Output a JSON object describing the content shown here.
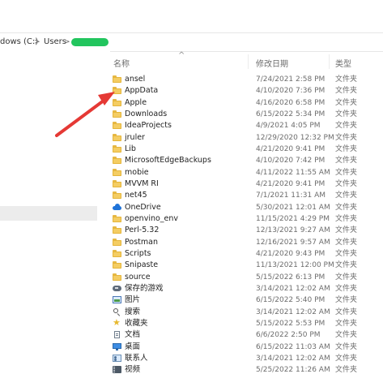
{
  "address_bar": {
    "path_start": "dows (C:)",
    "separator": ">",
    "users": "Users"
  },
  "columns": {
    "name": "名称",
    "modified": "修改日期",
    "type": "类型"
  },
  "sort_indicator": "^",
  "rows": [
    {
      "icon": "folder-icon",
      "name": "ansel",
      "date": "7/24/2021 2:58 PM",
      "type": "文件夹"
    },
    {
      "icon": "folder-icon",
      "name": "AppData",
      "date": "4/10/2020 7:36 PM",
      "type": "文件夹"
    },
    {
      "icon": "folder-icon",
      "name": "Apple",
      "date": "4/16/2020 6:58 PM",
      "type": "文件夹"
    },
    {
      "icon": "folder-icon",
      "name": "Downloads",
      "date": "6/15/2022 5:34 PM",
      "type": "文件夹"
    },
    {
      "icon": "folder-icon",
      "name": "IdeaProjects",
      "date": "4/9/2021 4:05 PM",
      "type": "文件夹"
    },
    {
      "icon": "folder-icon",
      "name": "jruler",
      "date": "12/29/2020 12:32 PM",
      "type": "文件夹"
    },
    {
      "icon": "folder-icon",
      "name": "Lib",
      "date": "4/21/2020 9:41 PM",
      "type": "文件夹"
    },
    {
      "icon": "folder-icon",
      "name": "MicrosoftEdgeBackups",
      "date": "4/10/2020 7:42 PM",
      "type": "文件夹"
    },
    {
      "icon": "folder-icon",
      "name": "mobie",
      "date": "4/11/2022 11:55 AM",
      "type": "文件夹"
    },
    {
      "icon": "folder-icon",
      "name": "MVVM RI",
      "date": "4/21/2020 9:41 PM",
      "type": "文件夹"
    },
    {
      "icon": "folder-icon",
      "name": "net45",
      "date": "7/1/2021 11:31 AM",
      "type": "文件夹"
    },
    {
      "icon": "onedrive-cloud-icon",
      "name": "OneDrive",
      "date": "5/30/2021 12:01 AM",
      "type": "文件夹"
    },
    {
      "icon": "folder-icon",
      "name": "openvino_env",
      "date": "11/15/2021 4:29 PM",
      "type": "文件夹"
    },
    {
      "icon": "folder-icon",
      "name": "Perl-5.32",
      "date": "12/13/2021 9:27 AM",
      "type": "文件夹"
    },
    {
      "icon": "folder-icon",
      "name": "Postman",
      "date": "12/16/2021 9:57 AM",
      "type": "文件夹"
    },
    {
      "icon": "folder-icon",
      "name": "Scripts",
      "date": "4/21/2020 9:43 PM",
      "type": "文件夹"
    },
    {
      "icon": "folder-icon",
      "name": "Snipaste",
      "date": "11/13/2021 12:00 PM",
      "type": "文件夹"
    },
    {
      "icon": "folder-icon",
      "name": "source",
      "date": "5/15/2022 6:13 PM",
      "type": "文件夹"
    },
    {
      "icon": "saved-games-icon",
      "name": "保存的游戏",
      "date": "3/14/2021 12:02 AM",
      "type": "文件夹"
    },
    {
      "icon": "pictures-icon",
      "name": "图片",
      "date": "6/15/2022 5:40 PM",
      "type": "文件夹"
    },
    {
      "icon": "search-icon",
      "name": "搜索",
      "date": "3/14/2021 12:02 AM",
      "type": "文件夹"
    },
    {
      "icon": "favorites-star-icon",
      "name": "收藏夹",
      "date": "5/15/2022 5:53 PM",
      "type": "文件夹"
    },
    {
      "icon": "document-icon",
      "name": "文档",
      "date": "6/6/2022 2:50 PM",
      "type": "文件夹"
    },
    {
      "icon": "desktop-icon",
      "name": "桌面",
      "date": "6/15/2022 11:03 AM",
      "type": "文件夹"
    },
    {
      "icon": "contacts-icon",
      "name": "联系人",
      "date": "3/14/2021 12:02 AM",
      "type": "文件夹"
    },
    {
      "icon": "video-icon",
      "name": "视频",
      "date": "5/25/2022 11:26 AM",
      "type": "文件夹"
    }
  ],
  "colors": {
    "folder": "#f4cd63",
    "folder_edge": "#e5b53b",
    "selection_gray": "#ececec",
    "address_redaction": "#22c55e",
    "arrow_red": "#e53935"
  }
}
